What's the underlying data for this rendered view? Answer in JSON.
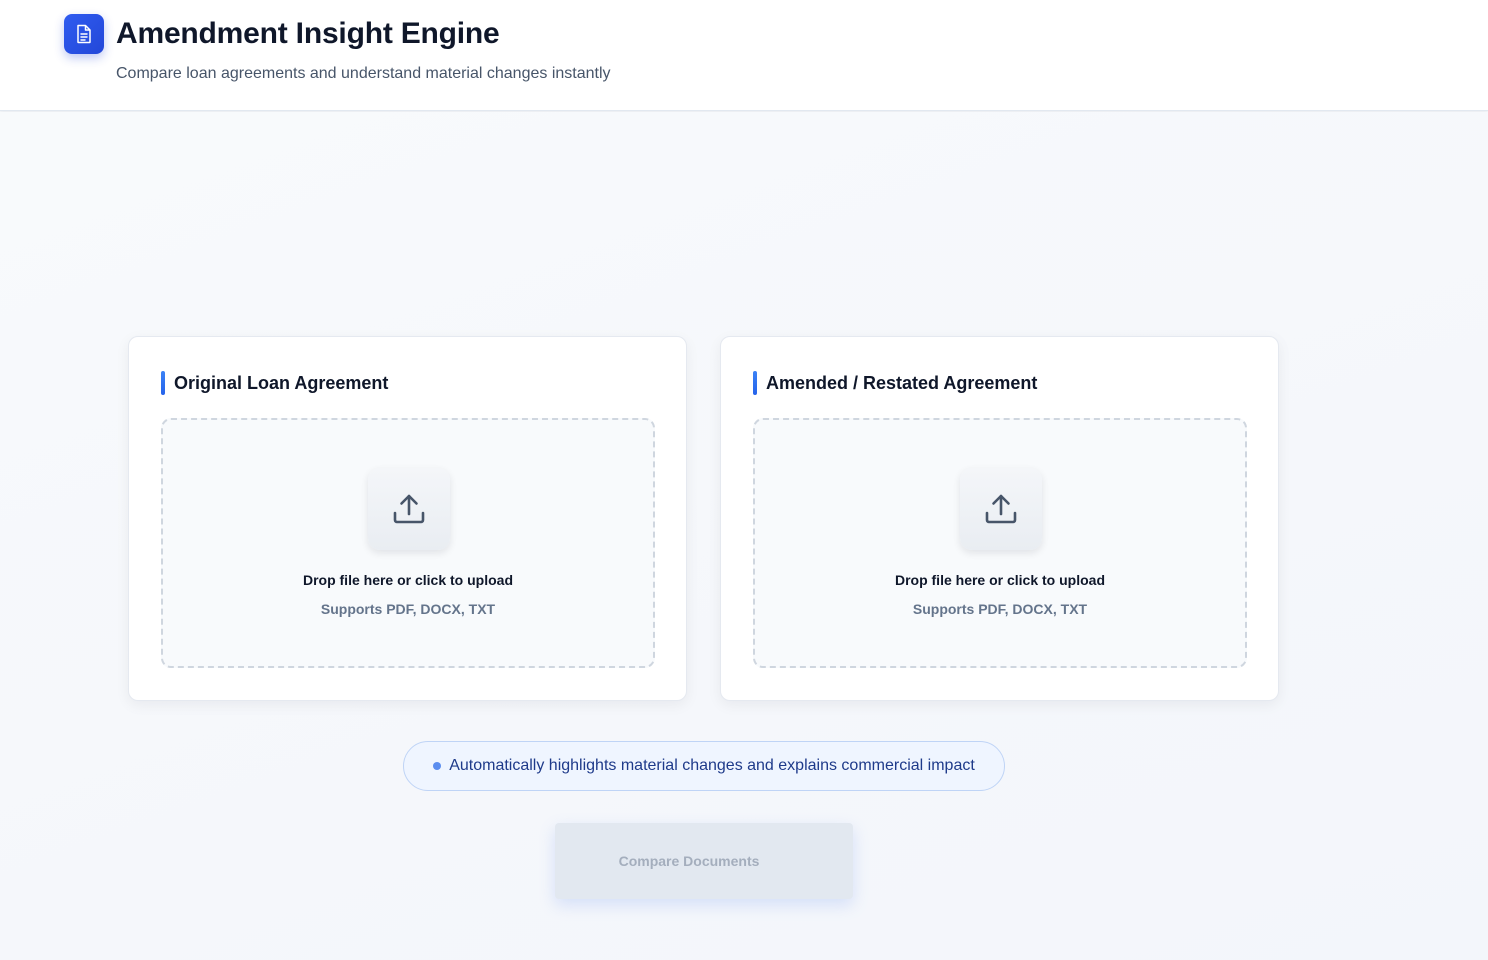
{
  "app": {
    "title": "Amendment Insight Engine",
    "subtitle": "Compare loan agreements and understand material changes instantly",
    "logo_icon": "document-icon",
    "accent_color": "#2f5cf0"
  },
  "upload_cards": [
    {
      "title": "Original Loan Agreement",
      "drop_label": "Drop file here or click to upload",
      "supported_formats": "Supports PDF, DOCX, TXT",
      "icon": "upload-icon"
    },
    {
      "title": "Amended / Restated Agreement",
      "drop_label": "Drop file here or click to upload",
      "supported_formats": "Supports PDF, DOCX, TXT",
      "icon": "upload-icon"
    }
  ],
  "info_banner": {
    "text": "Automatically highlights material changes and explains commercial impact"
  },
  "compare_button": {
    "label": "Compare Documents",
    "state": "disabled"
  }
}
